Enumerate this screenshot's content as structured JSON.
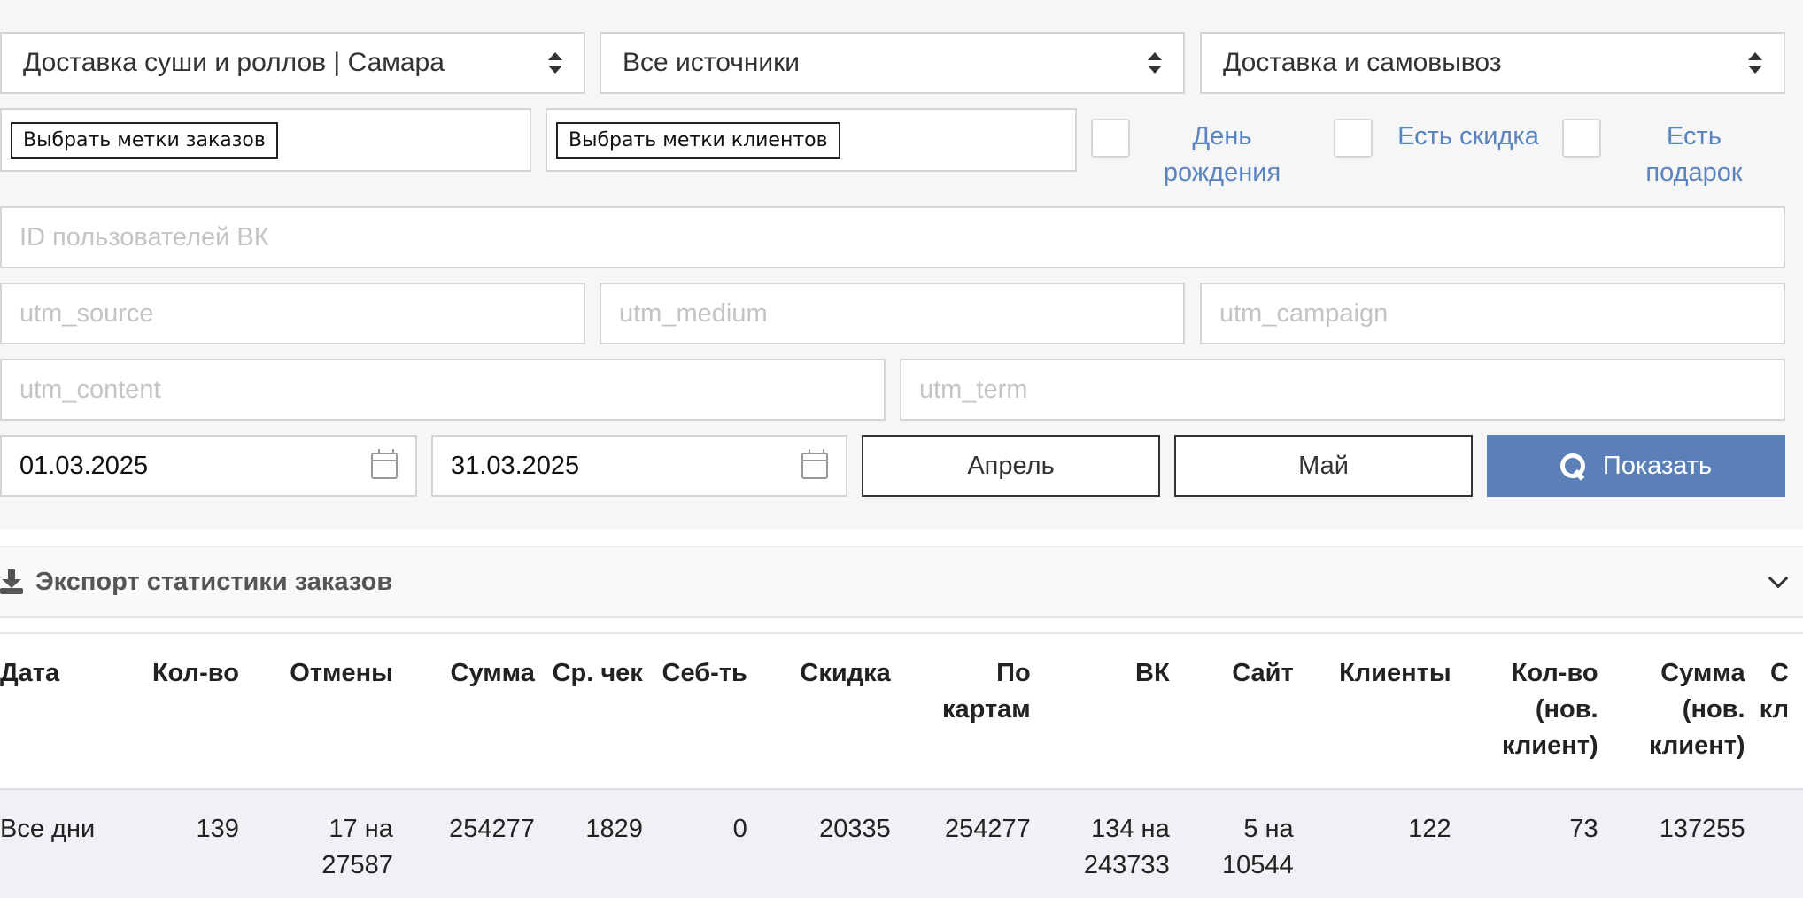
{
  "filters": {
    "restaurant": "Доставка суши и роллов | Самара",
    "source": "Все источники",
    "delivery": "Доставка и самовывоз",
    "order_tags_button": "Выбрать метки заказов",
    "client_tags_button": "Выбрать метки клиентов",
    "checkboxes": {
      "birthday": "День рождения",
      "discount": "Есть скидка",
      "gift": "Есть подарок"
    },
    "vk_ids_placeholder": "ID пользователей ВК",
    "utm_source_placeholder": "utm_source",
    "utm_medium_placeholder": "utm_medium",
    "utm_campaign_placeholder": "utm_campaign",
    "utm_content_placeholder": "utm_content",
    "utm_term_placeholder": "utm_term",
    "date_from": "01.03.2025",
    "date_to": "31.03.2025",
    "month_april": "Апрель",
    "month_may": "Май",
    "show_button": "Показать"
  },
  "export": {
    "title": "Экспорт статистики заказов"
  },
  "table": {
    "headers": [
      "Дата",
      "Кол-во",
      "Отмены",
      "Сумма",
      "Ср. чек",
      "Себ-ть",
      "Скидка",
      "По картам",
      "ВК",
      "Сайт",
      "Клиенты",
      "Кол-во (нов. клиент)",
      "Сумма (нов. клиент)",
      "С кл"
    ],
    "rows": [
      [
        "Все дни",
        "139",
        "17 на 27587",
        "254277",
        "1829",
        "0",
        "20335",
        "254277",
        "134 на 243733",
        "5 на 10544",
        "122",
        "73",
        "137255",
        ""
      ]
    ]
  }
}
